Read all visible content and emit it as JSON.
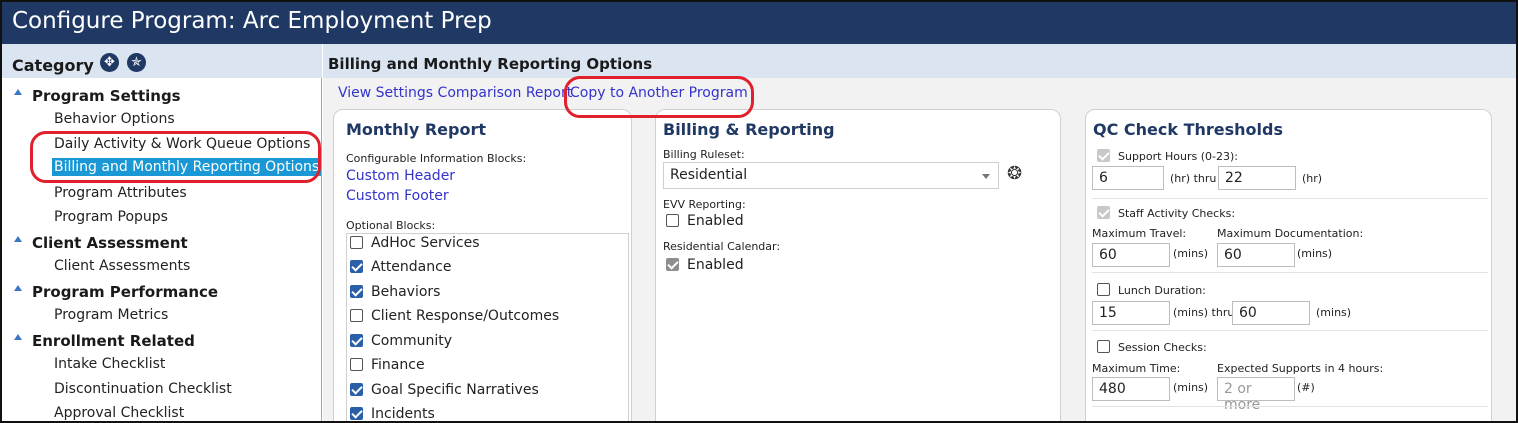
{
  "window": {
    "title": "Configure Program: Arc Employment Prep"
  },
  "category": {
    "label": "Category",
    "expand_icon": "expand-all-icon",
    "collapse_icon": "collapse-all-icon",
    "groups": [
      {
        "label": "Program Settings",
        "items": [
          "Behavior Options",
          "Daily Activity & Work Queue Options",
          "Billing and Monthly Reporting Options",
          "Program Attributes",
          "Program Popups"
        ]
      },
      {
        "label": "Client Assessment",
        "items": [
          "Client Assessments"
        ]
      },
      {
        "label": "Program Performance",
        "items": [
          "Program Metrics"
        ]
      },
      {
        "label": "Enrollment Related",
        "items": [
          "Intake Checklist",
          "Discontinuation Checklist",
          "Approval Checklist"
        ]
      }
    ],
    "selected": "Billing and Monthly Reporting Options"
  },
  "main": {
    "title": "Billing and Monthly Reporting Options",
    "links": {
      "comparison": "View Settings Comparison Report",
      "copy": "Copy to Another Program"
    },
    "monthly_report": {
      "title": "Monthly Report",
      "config_label": "Configurable Information Blocks:",
      "config_links": [
        "Custom Header",
        "Custom Footer"
      ],
      "optional_label": "Optional Blocks:",
      "optional_blocks": [
        {
          "label": "AdHoc Services",
          "checked": false
        },
        {
          "label": "Attendance",
          "checked": true
        },
        {
          "label": "Behaviors",
          "checked": true
        },
        {
          "label": "Client Response/Outcomes",
          "checked": false
        },
        {
          "label": "Community",
          "checked": true
        },
        {
          "label": "Finance",
          "checked": false
        },
        {
          "label": "Goal Specific Narratives",
          "checked": true
        },
        {
          "label": "Incidents",
          "checked": true
        }
      ]
    },
    "billing": {
      "title": "Billing & Reporting",
      "ruleset_label": "Billing Ruleset:",
      "ruleset_value": "Residential",
      "settings_icon": "gear-icon",
      "evv_label": "EVV Reporting:",
      "evv_enabled_label": "Enabled",
      "evv_enabled": false,
      "calendar_label": "Residential Calendar:",
      "calendar_enabled_label": "Enabled",
      "calendar_enabled": true
    },
    "qc": {
      "title": "QC Check Thresholds",
      "support_hours_label": "Support Hours (0-23):",
      "support_from": "6",
      "support_to": "22",
      "hr_unit": "(hr)",
      "hr_thru": "(hr) thru",
      "staff_activity_label": "Staff Activity Checks:",
      "max_travel_label": "Maximum Travel:",
      "max_travel_value": "60",
      "max_doc_label": "Maximum Documentation:",
      "max_doc_value": "60",
      "mins_unit": "(mins)",
      "mins_thru": "(mins) thru",
      "lunch_label": "Lunch Duration:",
      "lunch_from": "15",
      "lunch_to": "60",
      "session_label": "Session Checks:",
      "max_time_label": "Maximum Time:",
      "max_time_value": "480",
      "expected_label": "Expected Supports in 4 hours:",
      "expected_placeholder": "2 or more",
      "count_unit": "(#)"
    }
  }
}
